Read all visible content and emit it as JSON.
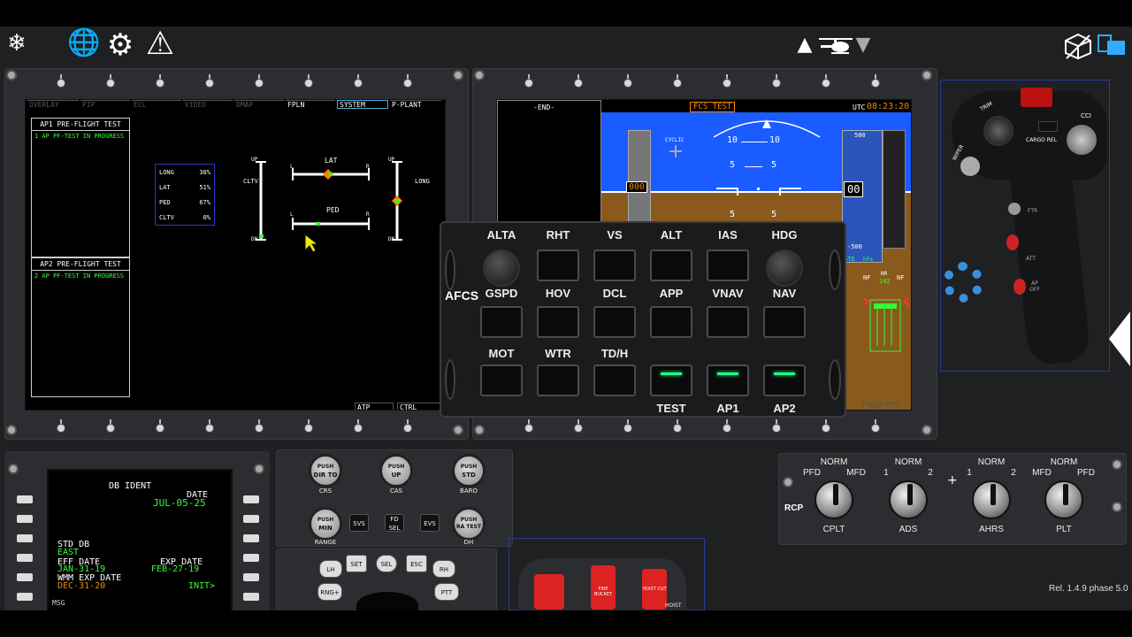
{
  "toolbar": {
    "snow_label": "❄",
    "globe_label": "🌐",
    "gear_label": "⚙",
    "warning_label": "⚠",
    "up_label": "▲",
    "down_label": "▼",
    "view_label": "⬡",
    "windows_label": "❐"
  },
  "mfd1": {
    "tabs": [
      "OVERLAY",
      "PIP",
      "ECL",
      "VIDEO",
      "DMAP",
      "FPLN",
      "SYSTEM",
      "P-PLANT"
    ],
    "bottom_tabs": [
      "ATP",
      "CTRL"
    ],
    "ap1_title": "AP1 PRE-FLIGHT TEST",
    "ap1_msg": "1 AP PF-TEST IN PROGRESS",
    "ap2_title": "AP2 PRE-FLIGHT TEST",
    "ap2_msg": "2 AP PF-TEST IN PROGRESS",
    "trims": [
      {
        "name": "LONG",
        "value": "38%"
      },
      {
        "name": "LAT",
        "value": "51%"
      },
      {
        "name": "PED",
        "value": "67%"
      },
      {
        "name": "CLTV",
        "value": "0%"
      }
    ],
    "lat_label": "LAT",
    "ped_label": "PED",
    "cltv_label": "CLTV",
    "long_label": "LONG",
    "up": "UP",
    "dn": "DN",
    "l": "L",
    "r": "R",
    "one": "1",
    "two": "2"
  },
  "mfd2": {
    "end_label": "-END-",
    "fcs_test": "FCS TEST",
    "utc_label": "UTC",
    "utc_time": "08:23:20",
    "cyclic_label": "CYCLIC",
    "pitch_10": "10",
    "pitch_5": "5",
    "speed_readout": "000",
    "alt_readout": "00",
    "alt_top": "500",
    "alt_bot": "-500",
    "std_label": "STD",
    "hpa_label": "hPa",
    "nf_label": "NF",
    "nr_label": "NR",
    "nr_value": "102",
    "bottom_tab": "OWNE R1"
  },
  "afcs": {
    "side_label": "AFCS",
    "row1": [
      "ALTA",
      "RHT",
      "VS",
      "ALT",
      "IAS",
      "HDG"
    ],
    "row2": [
      "GSPD",
      "HOV",
      "DCL",
      "APP",
      "VNAV",
      "NAV"
    ],
    "row3": [
      "MOT",
      "WTR",
      "TD/H"
    ],
    "row3_bottom": [
      "TEST",
      "AP1",
      "AP2"
    ],
    "lit_indices": [
      3,
      4,
      5
    ]
  },
  "cdu": {
    "title": "DB IDENT",
    "date_label": "DATE",
    "date_value": "JUL-05-25",
    "std_db_label": "STD DB",
    "std_db_value": "EAST",
    "eff_date_label": "EFF DATE",
    "eff_date_value": "JAN-31-19",
    "exp_date_label": "EXP DATE",
    "exp_date_value": "FEB-27-19",
    "wmm_label": "WMM EXP DATE",
    "wmm_value": "DEC-31-20",
    "init_label": "INIT>",
    "msg_label": "MSG"
  },
  "control_panel": {
    "dir_to": "DIR TO",
    "crs": "CRS",
    "up_push": "UP",
    "cas": "CAS",
    "std_push": "STD",
    "baro": "BARO",
    "min_push": "MIN",
    "range": "RANGE",
    "svs": "SVS",
    "fd_sel": "FD SEL",
    "evs": "EVS",
    "ra_test": "RA TEST",
    "dh": "DH",
    "push": "PUSH"
  },
  "nav_panel": {
    "set": "SET",
    "sel": "SEL",
    "esc": "ESC",
    "lh": "LH",
    "rh": "RH",
    "rng_plus": "RNG+",
    "ptt": "PTT"
  },
  "fire_panel": {
    "fire_bucket": "FIRE BUCKET",
    "hoist_cut": "HOIST CUT",
    "hoist": "HOIST"
  },
  "rcp": {
    "side_label": "RCP",
    "knobs": [
      {
        "top": "NORM",
        "left": "PFD",
        "right": "MFD",
        "bottom": "CPLT",
        "angle": 0
      },
      {
        "top": "NORM",
        "left": "1",
        "right": "2",
        "bottom": "ADS",
        "angle": 0
      },
      {
        "top": "NORM",
        "left": "1",
        "right": "2",
        "bottom": "AHRS",
        "angle": 0
      },
      {
        "top": "NORM",
        "left": "MFD",
        "right": "PFD",
        "bottom": "PLT",
        "angle": 0
      }
    ]
  },
  "collective": {
    "trim": "TRIM",
    "cci": "CCI",
    "wiper": "WIPER",
    "cargo_rel": "CARGO REL",
    "ftr": "FTR",
    "att": "ATT",
    "ap_off": "AP OFF"
  },
  "version": "Rel. 1.4.9 phase 5.0"
}
